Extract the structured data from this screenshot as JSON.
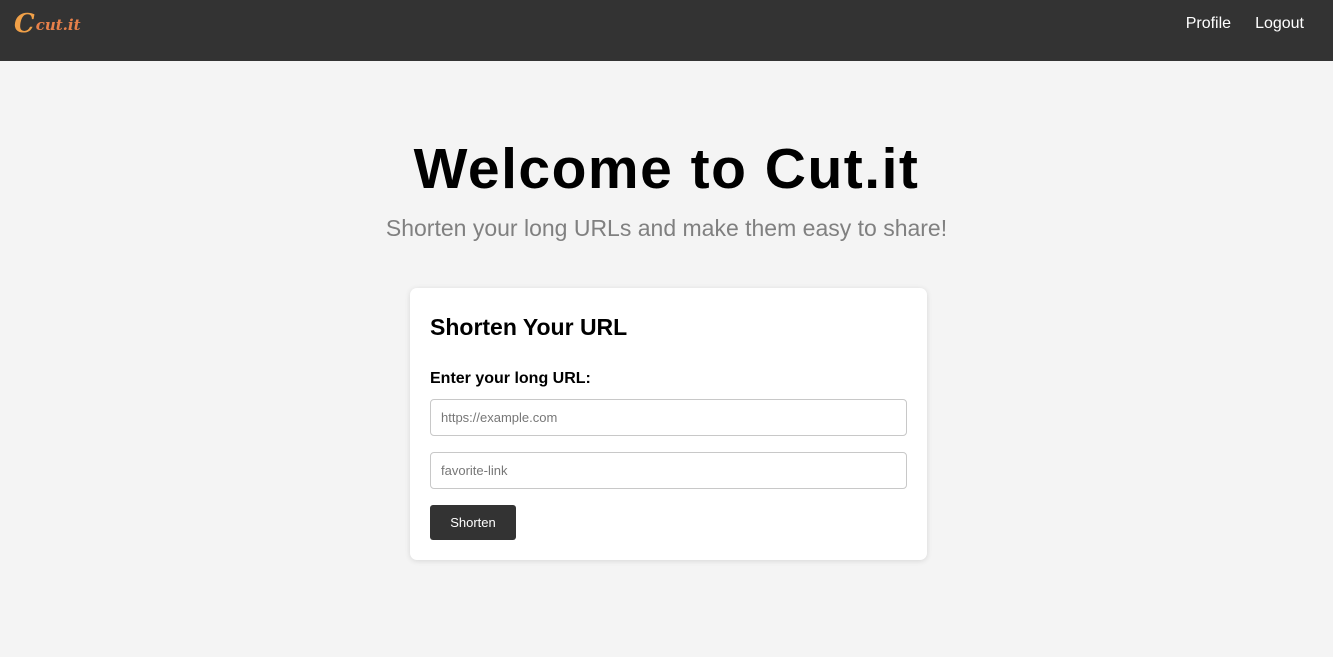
{
  "navbar": {
    "logo_mark": "C",
    "logo_text": "cut.it",
    "links": [
      {
        "label": "Profile"
      },
      {
        "label": "Logout"
      }
    ]
  },
  "hero": {
    "title": "Welcome to Cut.it",
    "subtitle": "Shorten your long URLs and make them easy to share!"
  },
  "form": {
    "title": "Shorten Your URL",
    "url_label": "Enter your long URL:",
    "url_placeholder": "https://example.com",
    "url_value": "",
    "alias_placeholder": "favorite-link",
    "alias_value": "",
    "submit_label": "Shorten"
  },
  "colors": {
    "navbar_bg": "#333333",
    "page_bg": "#f4f4f4",
    "logo_accent": "#f0a048",
    "button_bg": "#333333"
  }
}
